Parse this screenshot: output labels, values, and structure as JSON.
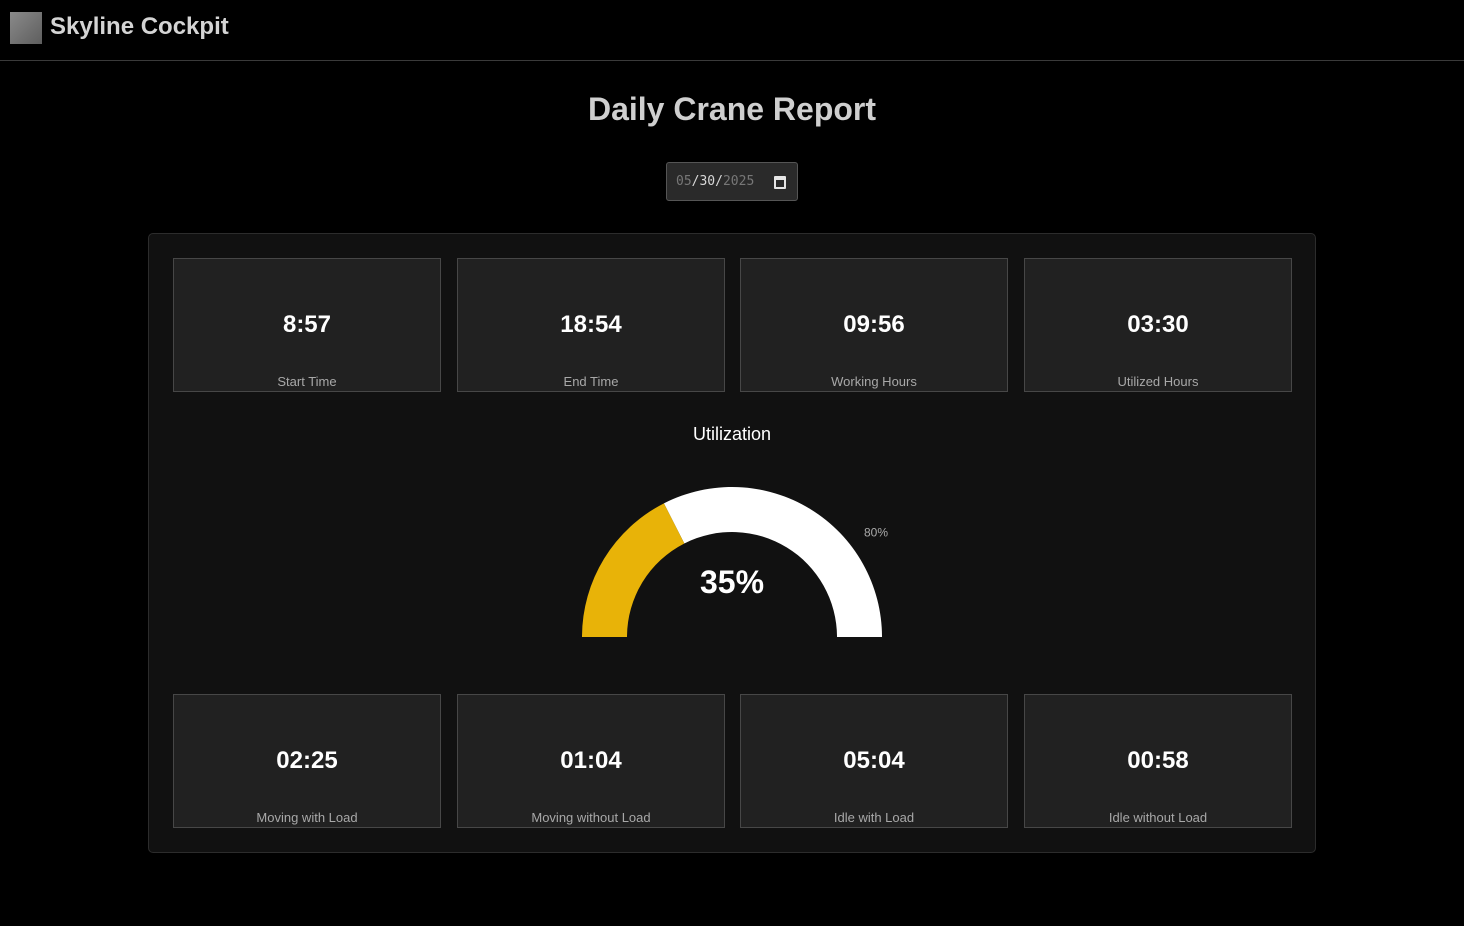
{
  "app": {
    "title": "Skyline Cockpit"
  },
  "page": {
    "title": "Daily Crane Report"
  },
  "date_picker": {
    "month": "05",
    "day": "30",
    "year": "2025",
    "value": "05/30/2025"
  },
  "top_stats": [
    {
      "value": "8:57",
      "label": "Start Time"
    },
    {
      "value": "18:54",
      "label": "End Time"
    },
    {
      "value": "09:56",
      "label": "Working Hours"
    },
    {
      "value": "03:30",
      "label": "Utilized Hours"
    }
  ],
  "utilization": {
    "title": "Utilization",
    "value_text": "35%",
    "value": 35,
    "target_label": "80%",
    "target": 80,
    "colors": {
      "fill": "#e8b308",
      "track": "#ffffff"
    }
  },
  "bottom_stats": [
    {
      "value": "02:25",
      "label": "Moving with Load"
    },
    {
      "value": "01:04",
      "label": "Moving without Load"
    },
    {
      "value": "05:04",
      "label": "Idle with Load"
    },
    {
      "value": "00:58",
      "label": "Idle without Load"
    }
  ]
}
